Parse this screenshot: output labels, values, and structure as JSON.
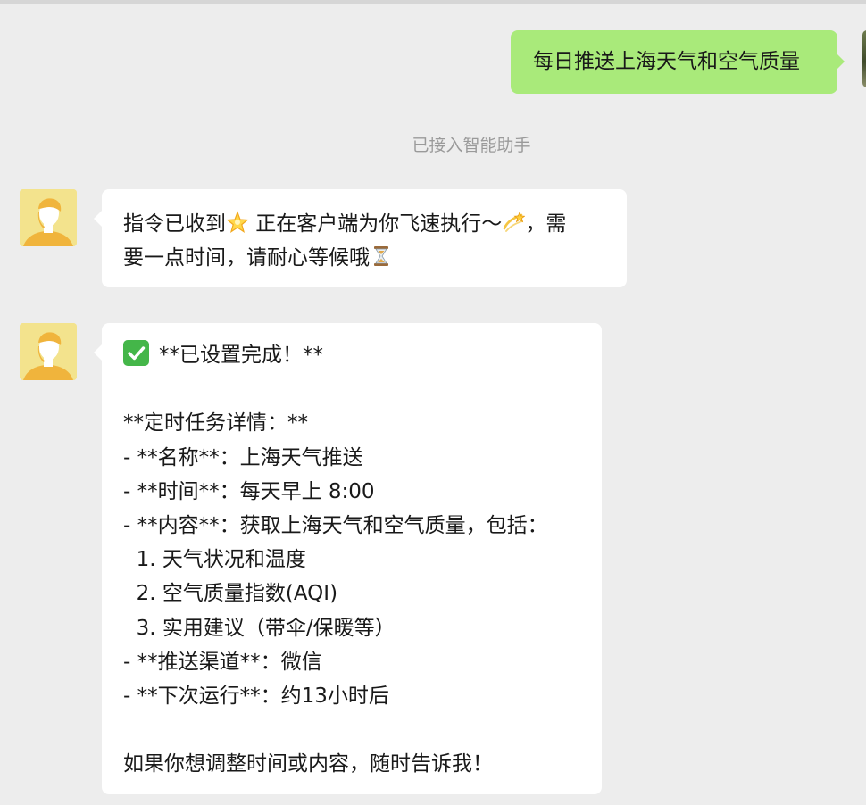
{
  "chat": {
    "outgoing_message": "每日推送上海天气和空气质量",
    "system_notice": "已接入智能助手",
    "reply_1": {
      "line_1_a": "指令已收到",
      "line_1_b": " 正在客户端为你飞速执行～",
      "line_1_c": "，需",
      "line_2": "要一点时间，请耐心等候哦"
    },
    "reply_2": {
      "header": "**已设置完成！**",
      "section_title": "**定时任务详情：**",
      "name_line": "- **名称**：上海天气推送",
      "time_line": "- **时间**：每天早上 8:00",
      "content_line": "- **内容**：获取上海天气和空气质量，包括：",
      "item_1": "  1. 天气状况和温度",
      "item_2": "  2. 空气质量指数(AQI)",
      "item_3": "  3. 实用建议（带伞/保暖等）",
      "channel_line": "- **推送渠道**：微信",
      "next_run_line": "- **下次运行**：约13小时后",
      "closing": "如果你想调整时间或内容，随时告诉我！"
    }
  },
  "icons": {
    "glowing_star": "glowing-star-emoji",
    "dizzy": "dizzy-emoji",
    "hourglass": "hourglass-emoji",
    "check_mark": "check-mark-button-emoji"
  },
  "colors": {
    "background": "#ededed",
    "outgoing_bubble": "#a9ea7a",
    "incoming_bubble": "#ffffff",
    "avatar_background": "#f3e38d",
    "check_mark": "#44b649",
    "system_text": "#9a9a9a"
  }
}
